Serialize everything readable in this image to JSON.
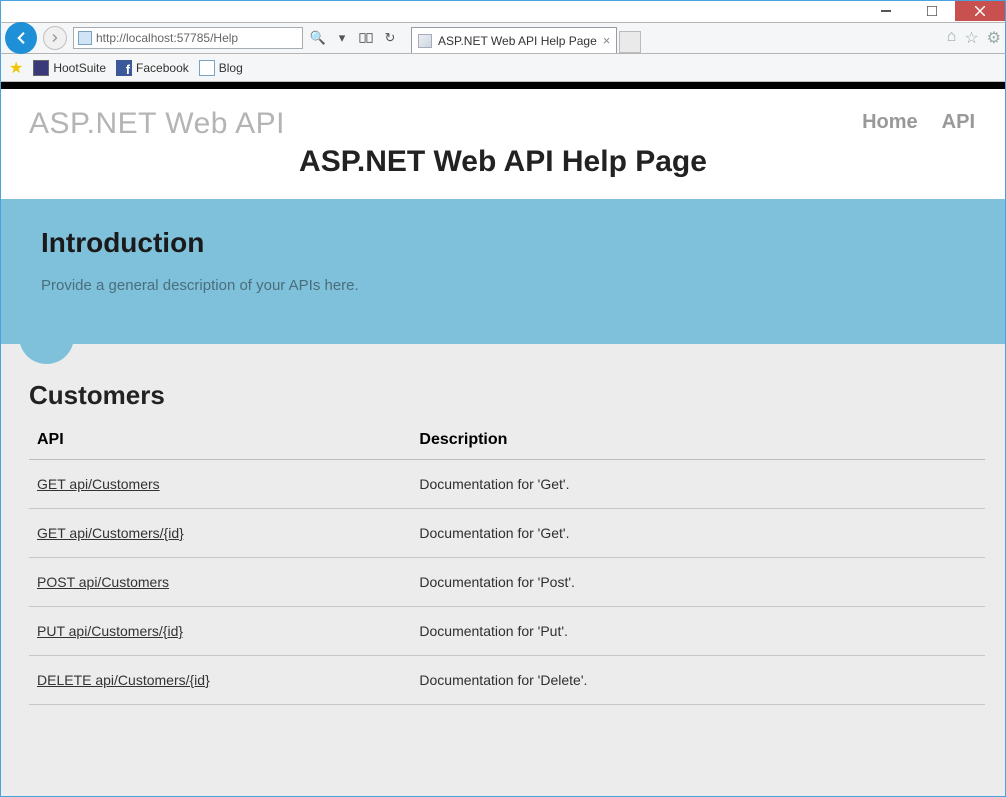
{
  "window": {
    "address_url": "http://localhost:57785/Help",
    "tab_title": "ASP.NET Web API Help Page"
  },
  "favorites": [
    {
      "label": "HootSuite"
    },
    {
      "label": "Facebook"
    },
    {
      "label": "Blog"
    }
  ],
  "header": {
    "brand": "ASP.NET Web API",
    "nav": {
      "home": "Home",
      "api": "API"
    },
    "page_title": "ASP.NET Web API Help Page"
  },
  "intro": {
    "heading": "Introduction",
    "text": "Provide a general description of your APIs here."
  },
  "api_section": {
    "title": "Customers",
    "columns": {
      "api": "API",
      "desc": "Description"
    },
    "rows": [
      {
        "api": "GET api/Customers",
        "desc": "Documentation for 'Get'."
      },
      {
        "api": "GET api/Customers/{id}",
        "desc": "Documentation for 'Get'."
      },
      {
        "api": "POST api/Customers",
        "desc": "Documentation for 'Post'."
      },
      {
        "api": "PUT api/Customers/{id}",
        "desc": "Documentation for 'Put'."
      },
      {
        "api": "DELETE api/Customers/{id}",
        "desc": "Documentation for 'Delete'."
      }
    ]
  }
}
